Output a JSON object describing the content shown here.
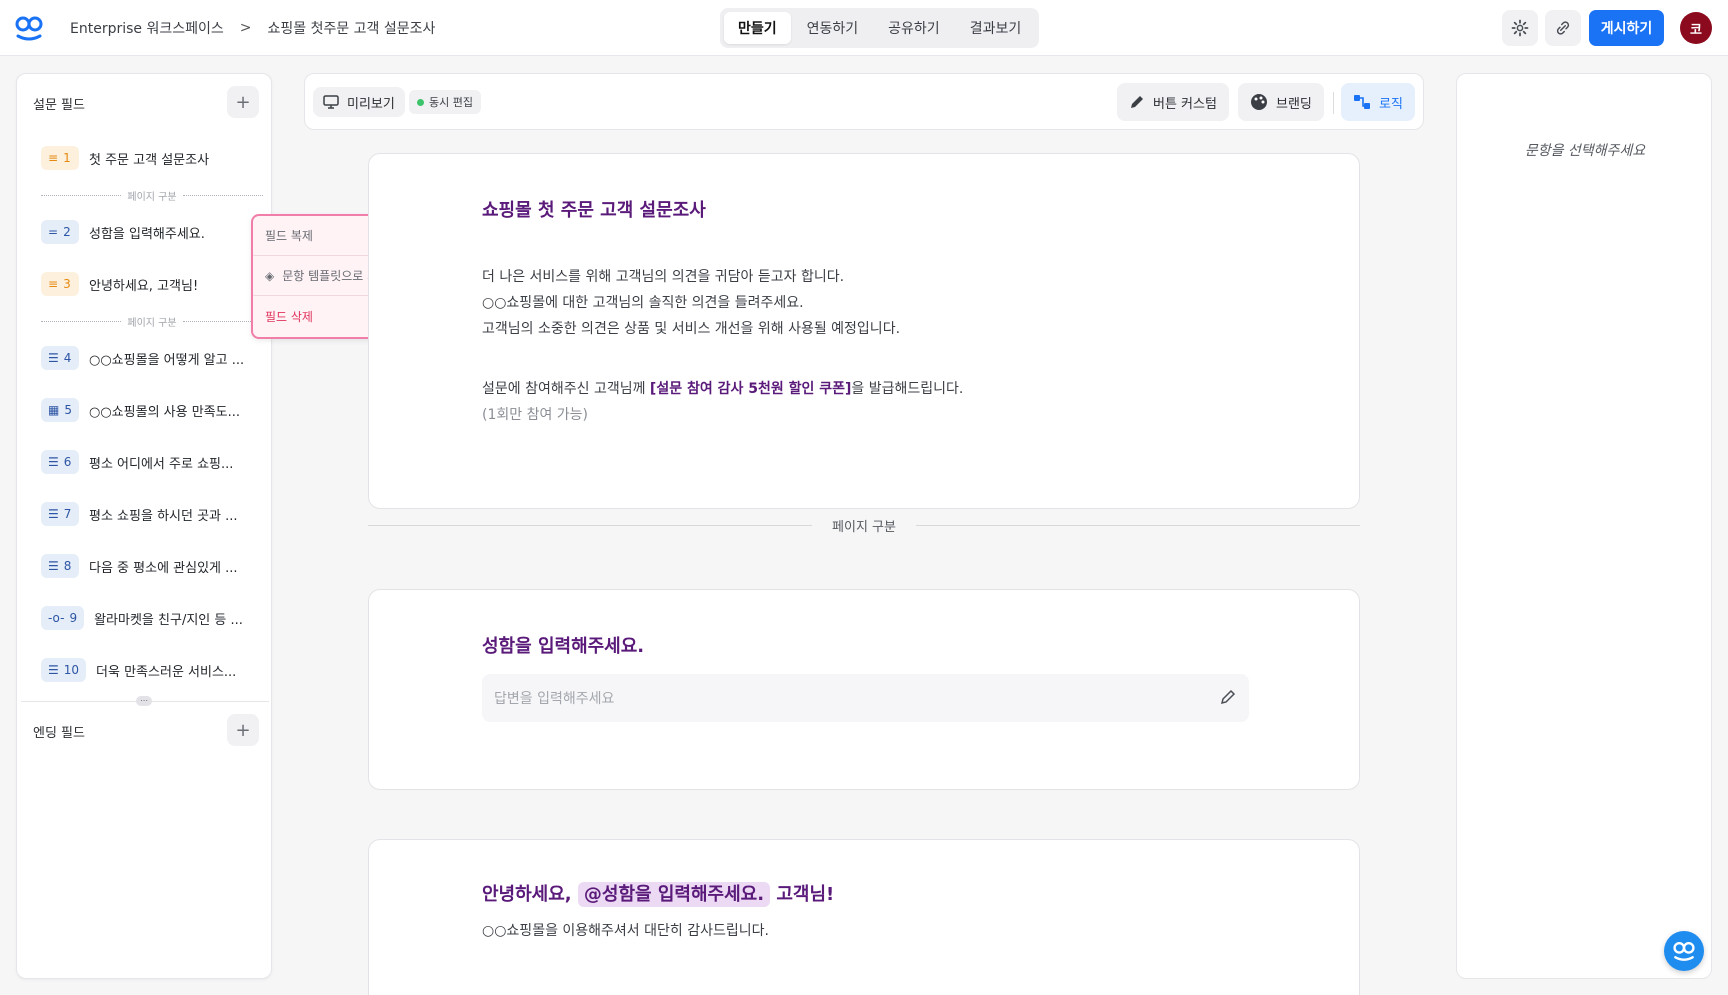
{
  "header": {
    "workspace": "Enterprise 워크스페이스",
    "breadcrumb_sep": ">",
    "survey_title": "쇼핑몰 첫주문 고객 설문조사",
    "tabs": [
      "만들기",
      "연동하기",
      "공유하기",
      "결과보기"
    ],
    "active_tab": "만들기",
    "publish_label": "게시하기",
    "avatar_initial": "코",
    "brand_color": "#1a73f5"
  },
  "sidebar": {
    "section_title": "설문 필드",
    "page_divider_label": "페이지 구분",
    "items": [
      {
        "num": "1",
        "label": "첫 주문 고객 설문조사",
        "icon": "text-lines-icon",
        "color": "orange"
      },
      {
        "num": "2",
        "label": "성함을 입력해주세요.",
        "icon": "short-text-icon",
        "color": "blue"
      },
      {
        "num": "3",
        "label": "안녕하세요, 고객님!",
        "icon": "text-lines-icon",
        "color": "orange"
      },
      {
        "num": "4",
        "label": "○○쇼핑몰을 어떻게 알고 ...",
        "icon": "list-icon",
        "color": "blue"
      },
      {
        "num": "5",
        "label": "○○쇼핑몰의 사용 만족도...",
        "icon": "grid-icon",
        "color": "blue"
      },
      {
        "num": "6",
        "label": "평소 어디에서 주로 쇼핑...",
        "icon": "list-icon",
        "color": "blue"
      },
      {
        "num": "7",
        "label": "평소 쇼핑을 하시던 곳과 ...",
        "icon": "list-icon",
        "color": "blue"
      },
      {
        "num": "8",
        "label": "다음 중 평소에 관심있게 ...",
        "icon": "list-icon",
        "color": "blue"
      },
      {
        "num": "9",
        "label": "왈라마켓을 친구/지인 등 ...",
        "icon": "slider-icon",
        "color": "blue"
      },
      {
        "num": "10",
        "label": "더욱 만족스러운 서비스...",
        "icon": "list-icon",
        "color": "blue"
      }
    ],
    "ending_title": "엔딩 필드"
  },
  "context_menu": {
    "items": [
      "필드 복제",
      "문항 템플릿으로 저장",
      "필드 삭제"
    ]
  },
  "toolbar": {
    "preview_label": "미리보기",
    "live_label": "동시 편집",
    "button_custom_label": "버튼 커스텀",
    "branding_label": "브랜딩",
    "logic_label": "로직"
  },
  "cards": {
    "intro": {
      "title": "쇼핑몰 첫 주문 고객 설문조사",
      "line1": "더 나은 서비스를 위해 고객님의 의견을 귀담아 듣고자 합니다.",
      "line2": "○○쇼핑몰에 대한 고객님의 솔직한 의견을 들려주세요.",
      "line3": "고객님의 소중한 의견은 상품 및 서비스 개선을 위해 사용될 예정입니다.",
      "line4_pre": "설문에 참여해주신 고객님께 ",
      "line4_bold": "[설문 참여 감사 5천원 할인 쿠폰]",
      "line4_post": "을 발급해드립니다.",
      "line5": "(1회만 참여 가능)"
    },
    "page_divider": "페이지 구분",
    "name": {
      "title": "성함을 입력해주세요.",
      "placeholder": "답변을 입력해주세요"
    },
    "greeting": {
      "title_pre": "안녕하세요,",
      "mention": "@성함을 입력해주세요.",
      "title_post": "고객님!",
      "body": "○○쇼핑몰을 이용해주셔서 대단히 감사드립니다."
    }
  },
  "right_panel": {
    "empty_text": "문항을 선택해주세요"
  }
}
